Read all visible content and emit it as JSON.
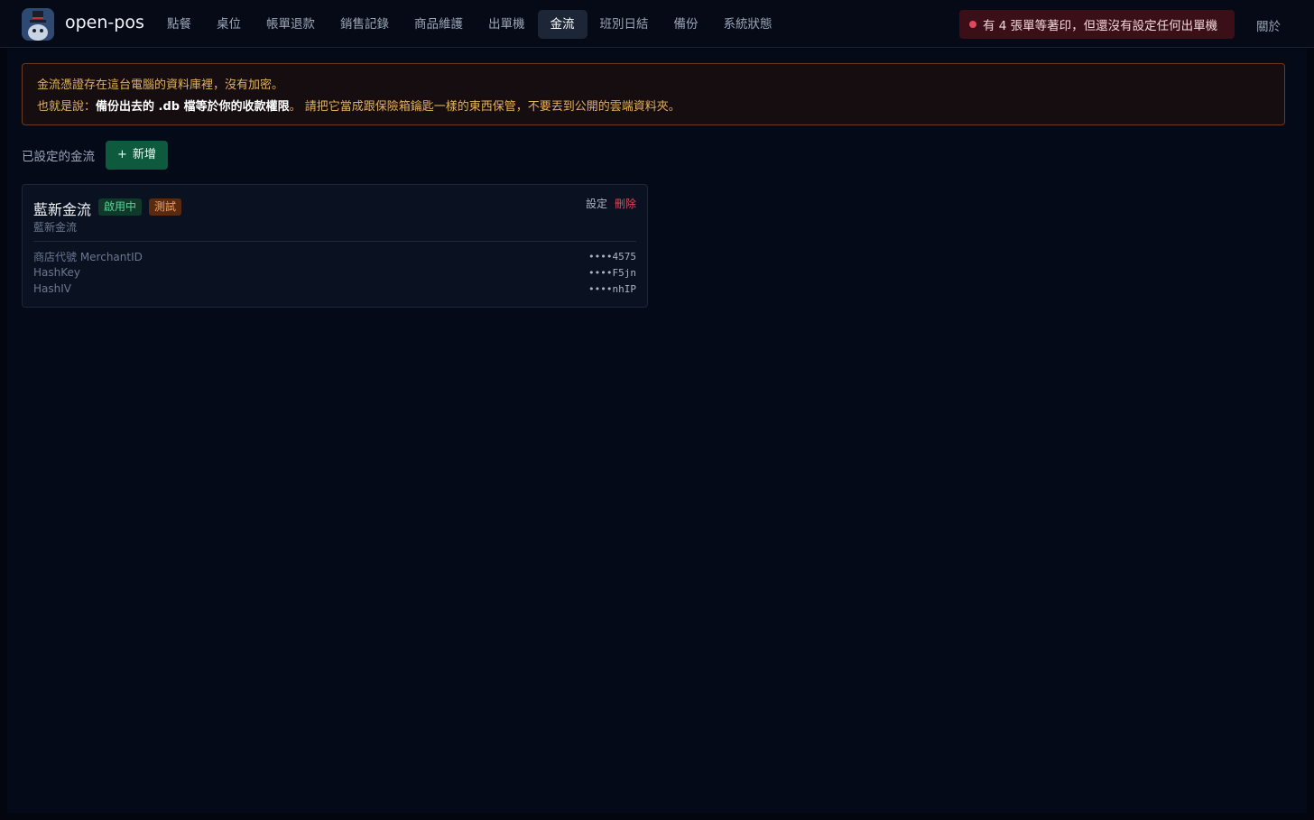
{
  "topbar": {
    "brand": "open-pos",
    "logo_icon": "magician-cat-logo",
    "nav": [
      {
        "label": "點餐",
        "active": false
      },
      {
        "label": "桌位",
        "active": false
      },
      {
        "label": "帳單退款",
        "active": false
      },
      {
        "label": "銷售記錄",
        "active": false
      },
      {
        "label": "商品維護",
        "active": false
      },
      {
        "label": "出單機",
        "active": false
      },
      {
        "label": "金流",
        "active": true
      },
      {
        "label": "班別日結",
        "active": false
      },
      {
        "label": "備份",
        "active": false
      },
      {
        "label": "系統狀態",
        "active": false
      }
    ],
    "alert": "有 4 張單等著印，但還沒有設定任何出單機",
    "about": "關於"
  },
  "warning": {
    "line1": "金流憑證存在這台電腦的資料庫裡，沒有加密。",
    "line2_prefix": "也就是說：",
    "line2_strong": "備份出去的 .db 檔等於你的收款權限",
    "line2_suffix": "。 請把它當成跟保險箱鑰匙一樣的東西保管，不要丟到公開的雲端資料夾。"
  },
  "section": {
    "label": "已設定的金流",
    "add_label": "新增",
    "add_icon": "plus-icon"
  },
  "provider": {
    "name": "藍新金流",
    "badge_active": "啟用中",
    "badge_test": "測試",
    "subtitle": "藍新金流",
    "settings_label": "設定",
    "delete_label": "刪除",
    "fields": [
      {
        "label": "商店代號 MerchantID",
        "value": "••••4575"
      },
      {
        "label": "HashKey",
        "value": "••••F5jn"
      },
      {
        "label": "HashIV",
        "value": "••••nhIP"
      }
    ]
  },
  "colors": {
    "accent_green": "#0e5a3f",
    "danger": "#e04a5a",
    "warning_text": "#e2b25c"
  }
}
